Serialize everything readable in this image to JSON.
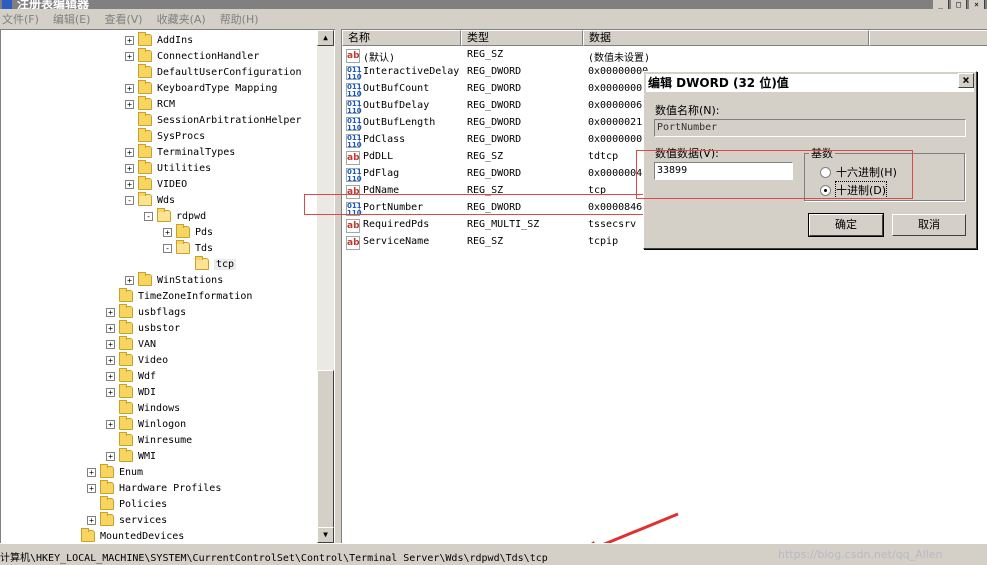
{
  "window": {
    "title": "注册表编辑器",
    "controls": [
      "_",
      "□",
      "×"
    ]
  },
  "menu": [
    "文件(F)",
    "编辑(E)",
    "查看(V)",
    "收藏夹(A)",
    "帮助(H)"
  ],
  "tree": [
    {
      "label": "AddIns",
      "level": 2,
      "expander": "+"
    },
    {
      "label": "ConnectionHandler",
      "level": 2,
      "expander": "+"
    },
    {
      "label": "DefaultUserConfiguration",
      "level": 2,
      "expander": ""
    },
    {
      "label": "KeyboardType Mapping",
      "level": 2,
      "expander": "+"
    },
    {
      "label": "RCM",
      "level": 2,
      "expander": "+"
    },
    {
      "label": "SessionArbitrationHelper",
      "level": 2,
      "expander": ""
    },
    {
      "label": "SysProcs",
      "level": 2,
      "expander": ""
    },
    {
      "label": "TerminalTypes",
      "level": 2,
      "expander": "+"
    },
    {
      "label": "Utilities",
      "level": 2,
      "expander": "+"
    },
    {
      "label": "VIDEO",
      "level": 2,
      "expander": "+"
    },
    {
      "label": "Wds",
      "level": 2,
      "expander": "-"
    },
    {
      "label": "rdpwd",
      "level": 3,
      "expander": "-"
    },
    {
      "label": "Pds",
      "level": 4,
      "expander": "+"
    },
    {
      "label": "Tds",
      "level": 4,
      "expander": "-"
    },
    {
      "label": "tcp",
      "level": 5,
      "expander": "",
      "selected": true
    },
    {
      "label": "WinStations",
      "level": 2,
      "expander": "+"
    },
    {
      "label": "TimeZoneInformation",
      "level": 1,
      "expander": ""
    },
    {
      "label": "usbflags",
      "level": 1,
      "expander": "+"
    },
    {
      "label": "usbstor",
      "level": 1,
      "expander": "+"
    },
    {
      "label": "VAN",
      "level": 1,
      "expander": "+"
    },
    {
      "label": "Video",
      "level": 1,
      "expander": "+"
    },
    {
      "label": "Wdf",
      "level": 1,
      "expander": "+"
    },
    {
      "label": "WDI",
      "level": 1,
      "expander": "+"
    },
    {
      "label": "Windows",
      "level": 1,
      "expander": ""
    },
    {
      "label": "Winlogon",
      "level": 1,
      "expander": "+"
    },
    {
      "label": "Winresume",
      "level": 1,
      "expander": ""
    },
    {
      "label": "WMI",
      "level": 1,
      "expander": "+"
    },
    {
      "label": "Enum",
      "level": 0,
      "expander": "+"
    },
    {
      "label": "Hardware Profiles",
      "level": 0,
      "expander": "+"
    },
    {
      "label": "Policies",
      "level": 0,
      "expander": ""
    },
    {
      "label": "services",
      "level": 0,
      "expander": "+"
    },
    {
      "label": "MountedDevices",
      "level": -1,
      "expander": ""
    }
  ],
  "list": {
    "columns": [
      "名称",
      "类型",
      "数据"
    ],
    "rows": [
      {
        "name": "(默认)",
        "type": "REG_SZ",
        "data": "(数值未设置)",
        "kind": "sz"
      },
      {
        "name": "InteractiveDelay",
        "type": "REG_DWORD",
        "data": "0x00000000",
        "kind": "bin"
      },
      {
        "name": "OutBufCount",
        "type": "REG_DWORD",
        "data": "0x0000000",
        "kind": "bin"
      },
      {
        "name": "OutBufDelay",
        "type": "REG_DWORD",
        "data": "0x0000006",
        "kind": "bin"
      },
      {
        "name": "OutBufLength",
        "type": "REG_DWORD",
        "data": "0x0000021",
        "kind": "bin"
      },
      {
        "name": "PdClass",
        "type": "REG_DWORD",
        "data": "0x0000000",
        "kind": "bin"
      },
      {
        "name": "PdDLL",
        "type": "REG_SZ",
        "data": "tdtcp",
        "kind": "sz"
      },
      {
        "name": "PdFlag",
        "type": "REG_DWORD",
        "data": "0x0000004",
        "kind": "bin"
      },
      {
        "name": "PdName",
        "type": "REG_SZ",
        "data": "tcp",
        "kind": "sz"
      },
      {
        "name": "PortNumber",
        "type": "REG_DWORD",
        "data": "0x0000846",
        "kind": "bin"
      },
      {
        "name": "RequiredPds",
        "type": "REG_MULTI_SZ",
        "data": "tssecsrv",
        "kind": "sz"
      },
      {
        "name": "ServiceName",
        "type": "REG_SZ",
        "data": "tcpip",
        "kind": "sz"
      }
    ]
  },
  "dialog": {
    "title": "编辑 DWORD (32 位)值",
    "close": "×",
    "name_label": "数值名称(N):",
    "name_value": "PortNumber",
    "data_label": "数值数据(V):",
    "data_value": "33899",
    "base_label": "基数",
    "radio_hex": "十六进制(H)",
    "radio_dec": "十进制(D)",
    "ok": "确定",
    "cancel": "取消"
  },
  "status": {
    "path": "计算机\\HKEY_LOCAL_MACHINE\\SYSTEM\\CurrentControlSet\\Control\\Terminal Server\\Wds\\rdpwd\\Tds\\tcp",
    "watermark": "https://blog.csdn.net/qq_Allen"
  },
  "colors": {
    "annotation": "#e04848",
    "arrow": "#e03030"
  }
}
